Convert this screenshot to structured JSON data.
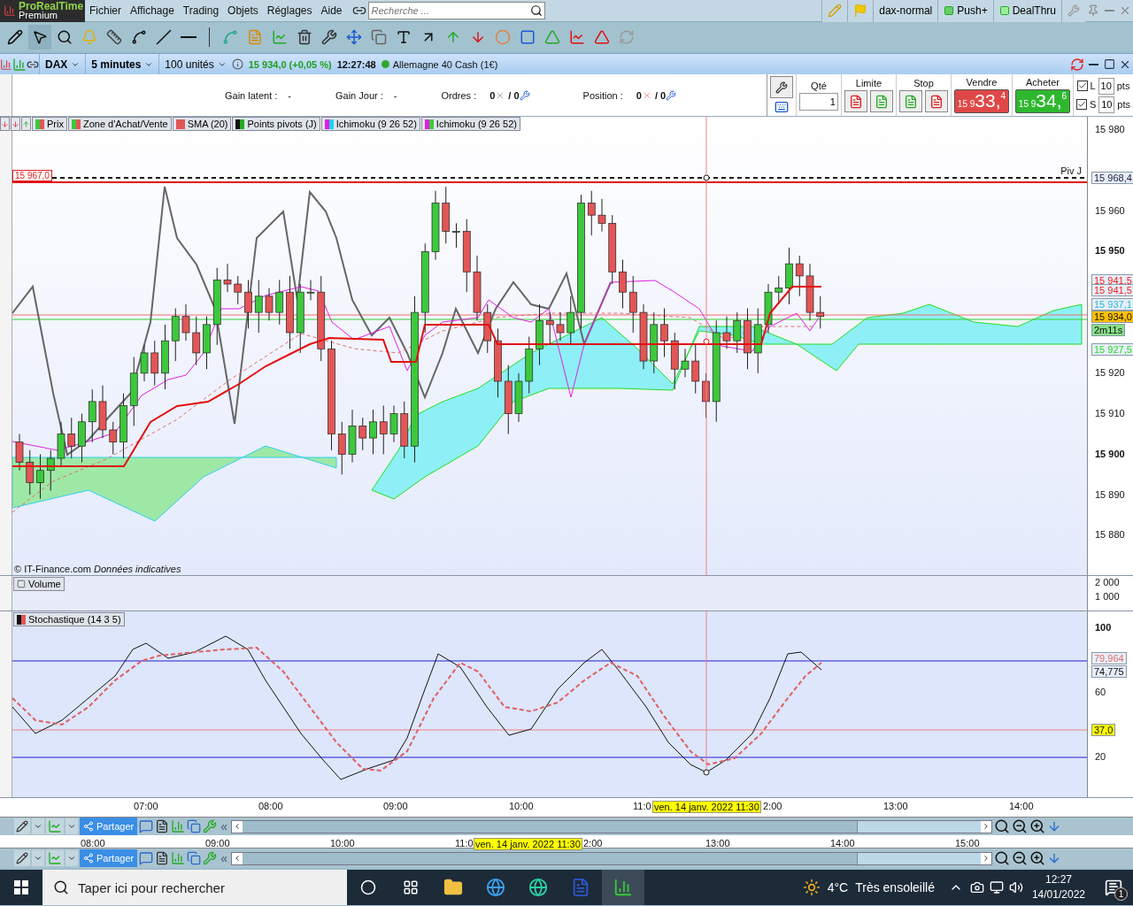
{
  "app_bar": {
    "logo": {
      "name": "ProRealTime",
      "edition": "Premium"
    },
    "menu": [
      "Fichier",
      "Affichage",
      "Trading",
      "Objets",
      "Réglages",
      "Aide"
    ],
    "search": {
      "placeholder": "Recherche ..."
    },
    "workspace": "dax-normal",
    "buttons": [
      "Push+",
      "DealThru"
    ]
  },
  "chart_window": {
    "instrument": "DAX",
    "timeframe": "5 minutes",
    "units": "100 unités",
    "price": "15 934,0 (+0,05 %)",
    "time": "12:27:48",
    "market_name": "Allemagne 40 Cash (1€)"
  },
  "trade_bar": {
    "stats": [
      {
        "label": "Gain latent :",
        "value": "-"
      },
      {
        "label": "Gain Jour :",
        "value": "-"
      }
    ],
    "orders": {
      "label": "Ordres :",
      "count": "0",
      "total": "/ 0"
    },
    "position": {
      "label": "Position :",
      "count": "0",
      "total": "/ 0"
    },
    "quantity": {
      "label": "Qté",
      "value": "1"
    },
    "limit_label": "Limite",
    "stop_label": "Stop",
    "sell": {
      "label": "Vendre",
      "prefix": "15 9",
      "big": "33,",
      "small": "4"
    },
    "buy": {
      "label": "Acheter",
      "prefix": "15 9",
      "big": "34,",
      "small": "6"
    },
    "offsets": [
      {
        "label": "L",
        "checked": true,
        "value": "10",
        "unit": "pts"
      },
      {
        "label": "S",
        "checked": true,
        "value": "10",
        "unit": "pts"
      }
    ]
  },
  "legend": [
    "Prix",
    "Zone d'Achat/Vente",
    "SMA (20)",
    "Points pivots (J)",
    "Ichimoku (9 26 52)",
    "Ichimoku (9 26 52)"
  ],
  "price_panel": {
    "left_tag": "15 967,0",
    "pivot_label": "Piv J",
    "source": "© IT-Finance.com *Données indicatives*",
    "axis": [
      {
        "text": "15 980",
        "major": false
      },
      {
        "text": "15 960",
        "major": false
      },
      {
        "text": "15 950",
        "major": true
      },
      {
        "text": "15 920",
        "major": false
      },
      {
        "text": "15 910",
        "major": false
      },
      {
        "text": "15 900",
        "major": true
      },
      {
        "text": "15 890",
        "major": false
      },
      {
        "text": "15 880",
        "major": false
      }
    ],
    "tags": [
      {
        "text": "15 968,4",
        "color": "#222244",
        "kind": "plain"
      },
      {
        "text": "15 941,5",
        "color": "#ee2222",
        "kind": "plain"
      },
      {
        "text": "15 941,5",
        "color": "#ee2222",
        "kind": "plain"
      },
      {
        "text": "15 937,1",
        "color": "#22b8d8",
        "kind": "plain"
      },
      {
        "text": "15 934,0",
        "color": "#ffc000",
        "kind": "filled"
      },
      {
        "text": "2m11s",
        "color": "#88e088",
        "kind": "filled"
      },
      {
        "text": "15 927,5",
        "color": "#22dd22",
        "kind": "plain"
      }
    ]
  },
  "volume_panel": {
    "legend": "Volume",
    "axis": [
      "2 000",
      "1 000"
    ]
  },
  "stochastic_panel": {
    "legend": "Stochastique (14 3 5)",
    "axis": [
      {
        "text": "100",
        "major": true
      },
      {
        "text": "60",
        "major": false
      },
      {
        "text": "20",
        "major": false
      }
    ],
    "tags": [
      {
        "text": "79,964",
        "color": "#e07070",
        "kind": "plain"
      },
      {
        "text": "74,775",
        "color": "#111111",
        "kind": "plain"
      },
      {
        "text": "37,0",
        "color": "#ffff00",
        "kind": "filled"
      }
    ]
  },
  "time_axis": [
    {
      "text": "07:00",
      "kind": "tick"
    },
    {
      "text": "08:00",
      "kind": "tick"
    },
    {
      "text": "09:00",
      "kind": "tick"
    },
    {
      "text": "10:00",
      "kind": "tick"
    },
    {
      "text": "11:0",
      "kind": "tick"
    },
    {
      "text": "ven. 14 janv. 2022 11:30",
      "kind": "cursor"
    },
    {
      "text": "2:00",
      "kind": "tick"
    },
    {
      "text": "13:00",
      "kind": "tick"
    },
    {
      "text": "14:00",
      "kind": "tick"
    }
  ],
  "toolbar_1": {
    "share": "Partager",
    "collapse": "«"
  },
  "time_axis_2": [
    {
      "text": "08:00",
      "kind": "tick"
    },
    {
      "text": "09:00",
      "kind": "tick"
    },
    {
      "text": "10:00",
      "kind": "tick"
    },
    {
      "text": "11:0",
      "kind": "tick"
    },
    {
      "text": "ven. 14 janv. 2022 11:30",
      "kind": "cursor"
    },
    {
      "text": "2:00",
      "kind": "tick"
    },
    {
      "text": "13:00",
      "kind": "tick"
    },
    {
      "text": "14:00",
      "kind": "tick"
    },
    {
      "text": "15:00",
      "kind": "tick"
    }
  ],
  "toolbar_2": {
    "share": "Partager",
    "collapse": "«"
  },
  "taskbar": {
    "search": {
      "placeholder": "Taper ici pour rechercher"
    },
    "temperature": "4°C",
    "weather": "Très ensoleillé",
    "time": "12:27",
    "date": "14/01/2022",
    "notifications": "1"
  }
}
